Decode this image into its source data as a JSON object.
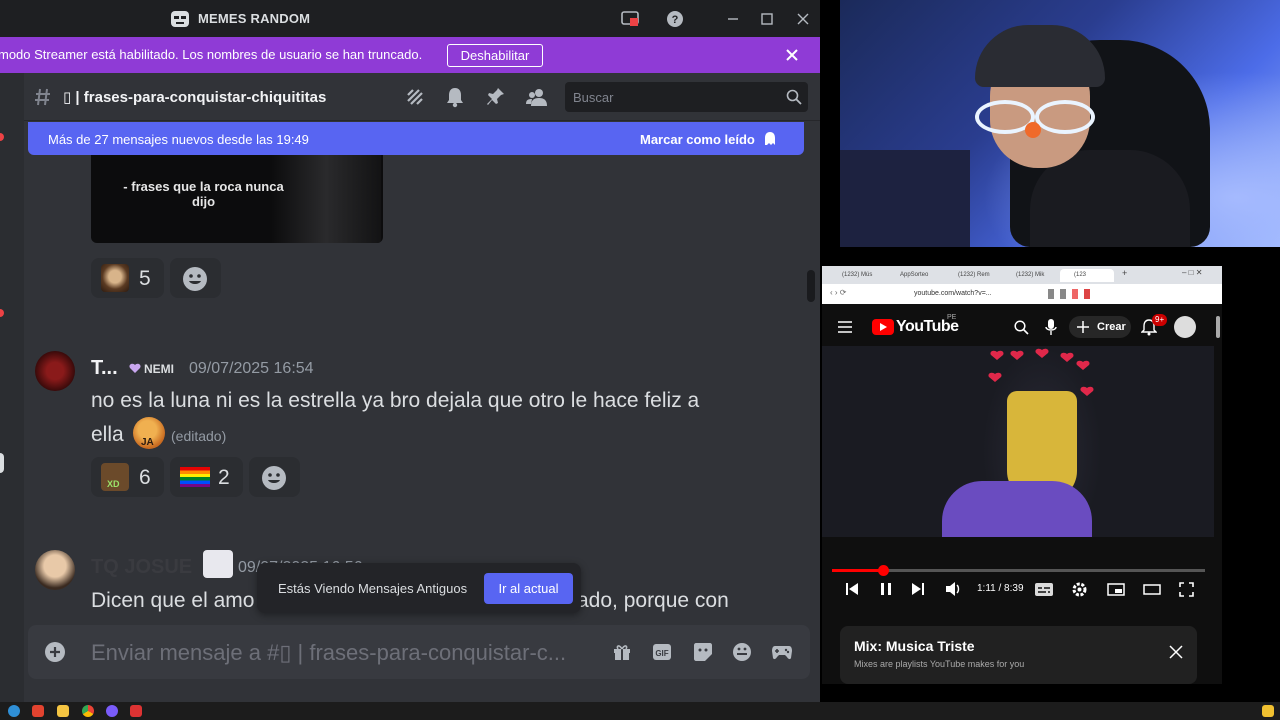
{
  "discord": {
    "window_title": "MEMES RANDOM",
    "streamer_banner": {
      "message": "modo Streamer está habilitado. Los nombres de usuario se han truncado.",
      "disable_label": "Deshabilitar"
    },
    "channel": {
      "name": "▯ | frases-para-conquistar-chiquititas",
      "search_placeholder": "Buscar"
    },
    "new_messages_bar": {
      "text": "Más de 27 mensajes nuevos desde las 19:49",
      "mark_read_label": "Marcar como leído"
    },
    "image_caption": "- frases que la roca nunca dijo",
    "messages": [
      {
        "reactions": [
          {
            "emoji": "monkey-emoji",
            "count": "5"
          }
        ]
      },
      {
        "author": "T...",
        "tag": "NEMI",
        "timestamp": "09/07/2025 16:54",
        "line1": "no es la luna ni es la estrella ya bro dejala que otro le hace feliz a",
        "line2": "ella",
        "edited": "(editado)",
        "emoji_label": "JA",
        "reactions": [
          {
            "emoji": "xd-emoji",
            "label": "XD",
            "count": "6"
          },
          {
            "emoji": "rainbow-flag-emoji",
            "count": "2"
          }
        ]
      },
      {
        "author": "TQ JOSUE",
        "timestamp": "09/07/2025 16:56",
        "line1_start": "Dicen que el amo",
        "line1_end": "ado, porque con"
      }
    ],
    "old_messages_pill": {
      "text": "Estás Viendo Mensajes Antiguos",
      "button": "Ir al actual"
    },
    "composer_placeholder": "Enviar mensaje a #▯ | frases-para-conquistar-c..."
  },
  "browser": {
    "tabs": [
      "(1232) Mús",
      "AppSorteo",
      "(1232) Rem",
      "(1232) Mik",
      "(123"
    ],
    "url": "youtube.com/watch?v=...",
    "youtube": {
      "logo_text": "YouTube",
      "region": "PE",
      "create_label": "Crear",
      "notifications": "9+",
      "time": "1:11 / 8:39",
      "progress_fraction": 0.137,
      "mix_title": "Mix: Musica Triste",
      "mix_subtitle": "Mixes are playlists YouTube makes for you"
    }
  },
  "colors": {
    "discord_bg": "#313338",
    "blurple": "#5865f2",
    "streamer_purple": "#8f3bd6",
    "youtube_red": "#ff0000"
  }
}
